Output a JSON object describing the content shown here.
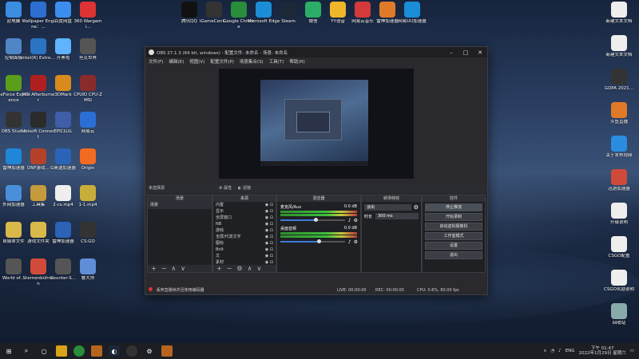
{
  "desktop_icons_left": [
    {
      "label": "此电脑",
      "color": "#3a8de0"
    },
    {
      "label": "Wallpaper Engine：…",
      "color": "#2c6fd1"
    },
    {
      "label": "百度网盘",
      "color": "#3b8ef0"
    },
    {
      "label": "360 Wargami…",
      "color": "#d33"
    },
    {
      "label": "控制面板",
      "color": "#4f86c6"
    },
    {
      "label": "Intel(R) Extre…",
      "color": "#2a74c4"
    },
    {
      "label": "开黑啦",
      "color": "#5fb3ff"
    },
    {
      "label": "坦克世界",
      "color": "#555"
    },
    {
      "label": "GeForce Experience",
      "color": "#5a9e1b"
    },
    {
      "label": "MSI Afterburner",
      "color": "#b02020"
    },
    {
      "label": "3DMark",
      "color": "#d88b1c"
    },
    {
      "label": "CPUID CPU-Z MSI",
      "color": "#8a2b2b"
    },
    {
      "label": "OBS Studio",
      "color": "#333"
    },
    {
      "label": "Ubisoft Connect",
      "color": "#2b2b2b"
    },
    {
      "label": "EPIC红红",
      "color": "#3f5ea8"
    },
    {
      "label": "网易云",
      "color": "#2b6fd6"
    },
    {
      "label": "雷神加速器",
      "color": "#1f86d8"
    },
    {
      "label": "DNF游戏…",
      "color": "#b5412a"
    },
    {
      "label": "G奥迪加速器",
      "color": "#2a63b8"
    },
    {
      "label": "Origin",
      "color": "#f36b21"
    },
    {
      "label": "外网加速器",
      "color": "#4a8fda"
    },
    {
      "label": "工具集",
      "color": "#c49a3a"
    },
    {
      "label": "2-cs.mp4",
      "color": "#eee"
    },
    {
      "label": "1-1.mp4",
      "color": "#c7ad3a"
    },
    {
      "label": "自媒体文件",
      "color": "#d9b84a"
    },
    {
      "label": "游戏文件夹",
      "color": "#d9b84a"
    },
    {
      "label": "雷神加速器",
      "color": "#2a63b8"
    },
    {
      "label": "CS:GO",
      "color": "#333"
    },
    {
      "label": "World of…",
      "color": "#555"
    },
    {
      "label": "Sternenbühnen",
      "color": "#d24b3a"
    },
    {
      "label": "Counter-S…",
      "color": "#555"
    },
    {
      "label": "鲁大师",
      "color": "#5f8ed6"
    }
  ],
  "desktop_icons_top": [
    {
      "label": "腾讯QQ",
      "color": "#111"
    },
    {
      "label": "iGameCent…",
      "color": "#333"
    },
    {
      "label": "Google Chrome",
      "color": "#2a8d3a"
    },
    {
      "label": "Microsoft Edge",
      "color": "#1b8dd6"
    },
    {
      "label": "Steam",
      "color": "#1b2838"
    },
    {
      "label": "微信",
      "color": "#2aae67"
    },
    {
      "label": "YY语音",
      "color": "#f0b62a"
    },
    {
      "label": "网易云音乐",
      "color": "#d43a3a"
    },
    {
      "label": "雷神加速器",
      "color": "#e07a28"
    },
    {
      "label": "网易UU加速器",
      "color": "#1b8dd6"
    }
  ],
  "desktop_icons_right": [
    {
      "label": "新建文本文档",
      "color": "#eee"
    },
    {
      "label": "新建文本文档",
      "color": "#eee"
    },
    {
      "label": "GOPA 2021…",
      "color": "#333"
    },
    {
      "label": "斗鱼直播",
      "color": "#e07a28"
    },
    {
      "label": "关于发布视频",
      "color": "#2a8de0"
    },
    {
      "label": "迅游加速器",
      "color": "#d04a3a"
    },
    {
      "label": "升级说明",
      "color": "#eee"
    },
    {
      "label": "CSGO配置",
      "color": "#eee"
    },
    {
      "label": "CSGO奖励说明",
      "color": "#eee"
    },
    {
      "label": "回收站",
      "color": "#8aa"
    }
  ],
  "obs": {
    "title": "OBS 27.1.3 (64 bit, windows) - 配置文件: 未命名 - 场景: 未命名",
    "menu": [
      "文件(F)",
      "编辑(E)",
      "视图(V)",
      "配置文件(P)",
      "场景集合(S)",
      "工具(T)",
      "帮助(H)"
    ],
    "source_bar": {
      "label": "未选择源",
      "props": "属性",
      "filters": "滤镜"
    },
    "docks": {
      "scenes": {
        "title": "场景",
        "items": [
          "场景"
        ]
      },
      "sources": {
        "title": "来源",
        "items": [
          "内置",
          "显示",
          "全屏窗口",
          "NB",
          "游戏",
          "全屏/代发文字",
          "图标",
          "Bolt",
          "文",
          "素材"
        ]
      },
      "mixer": {
        "title": "混音器",
        "channels": [
          {
            "name": "麦克风/Aux",
            "db": "0.0 dB",
            "level": 0.55
          },
          {
            "name": "桌面音频",
            "db": "0.0 dB",
            "level": 0.6
          }
        ]
      },
      "transitions": {
        "title": "转场特效",
        "type": "淡出",
        "duration_label": "时长",
        "duration": "300 ms"
      },
      "controls": {
        "title": "控件",
        "buttons": [
          "停止推流",
          "开始录制",
          "启动虚拟摄像机",
          "工作室模式",
          "设置",
          "退出"
        ]
      }
    },
    "statusbar": {
      "live": "LIVE: 00:00:00",
      "rec": "REC: 00:00:00",
      "cpu": "CPU: 0.6%, 60.00 fps",
      "warning": "丢弃直播帧并且使用编码器"
    }
  },
  "taskbar": {
    "apps": [
      "start",
      "search",
      "task-view",
      "app1",
      "chrome",
      "obs",
      "steam",
      "app2",
      "settings",
      "app3"
    ],
    "tray": {
      "lang": "ENG",
      "time": "下午 01:47",
      "date": "2022年1月29日 星期六"
    }
  }
}
